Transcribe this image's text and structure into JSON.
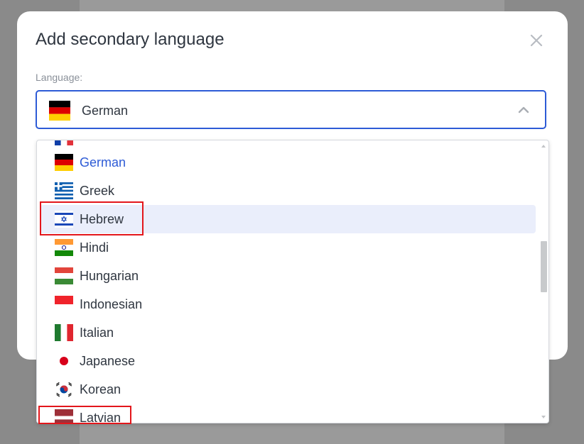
{
  "modal": {
    "title": "Add secondary language",
    "close_icon": "close-icon",
    "field_label": "Language:",
    "selected_language": "German",
    "selected_flag": "germany-flag-icon"
  },
  "dropdown": {
    "options": [
      {
        "label": "German",
        "flag": "germany-flag-icon",
        "selected": true
      },
      {
        "label": "Greek",
        "flag": "greece-flag-icon"
      },
      {
        "label": "Hebrew",
        "flag": "israel-flag-icon",
        "hovered": true
      },
      {
        "label": "Hindi",
        "flag": "india-flag-icon"
      },
      {
        "label": "Hungarian",
        "flag": "hungary-flag-icon"
      },
      {
        "label": "Indonesian",
        "flag": "indonesia-flag-icon"
      },
      {
        "label": "Italian",
        "flag": "italy-flag-icon"
      },
      {
        "label": "Japanese",
        "flag": "japan-flag-icon"
      },
      {
        "label": "Korean",
        "flag": "korea-flag-icon"
      },
      {
        "label": "Latvian",
        "flag": "latvia-flag-icon"
      }
    ]
  },
  "colors": {
    "accent": "#2d5bd6",
    "highlight": "#eaeefb",
    "annotation": "#e3161b"
  }
}
